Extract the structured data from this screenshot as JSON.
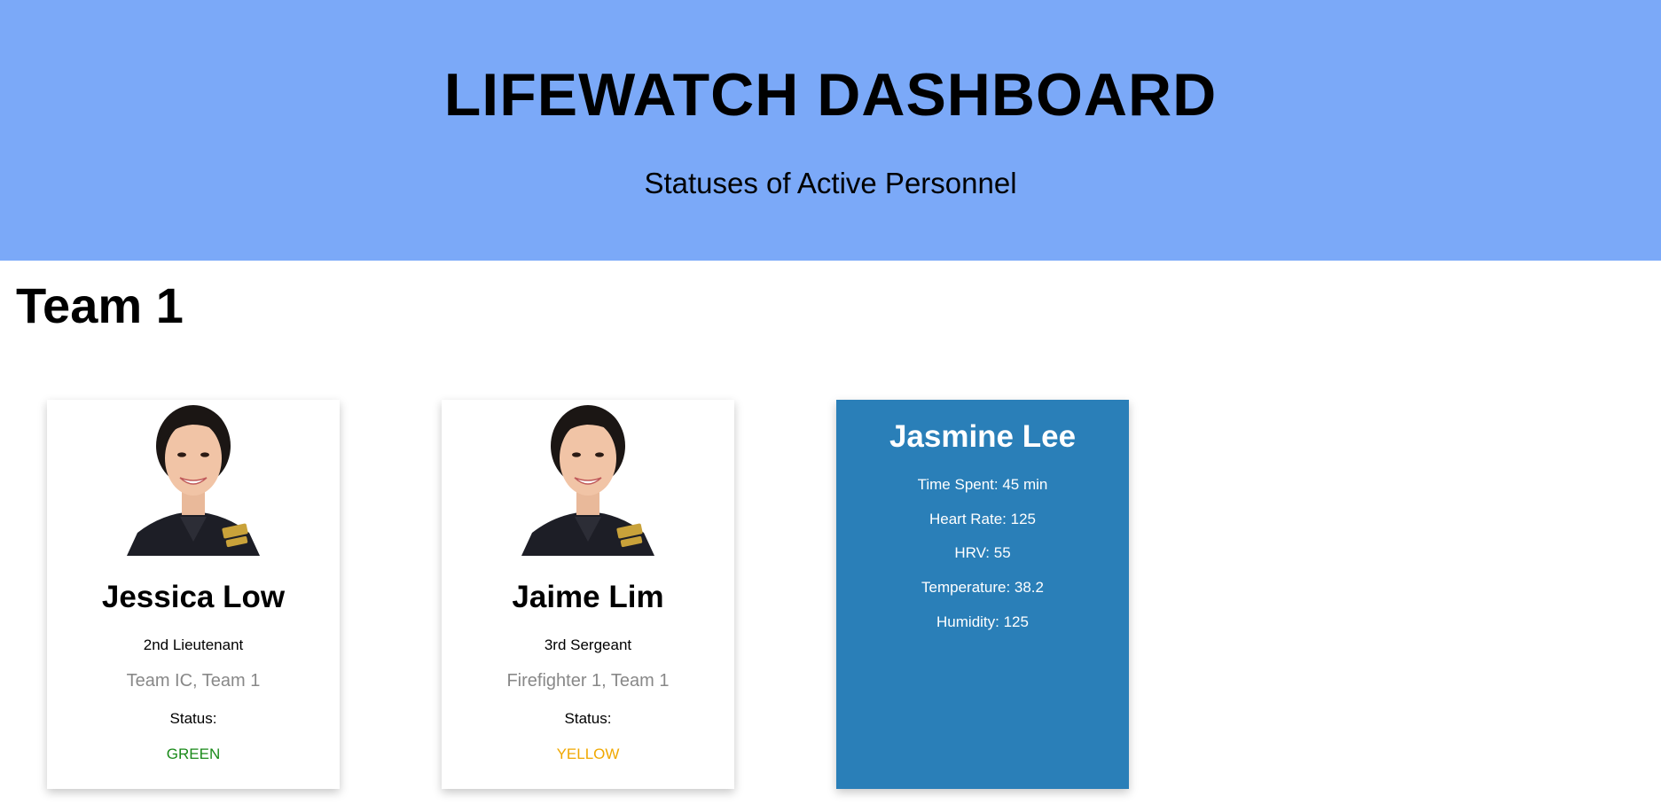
{
  "header": {
    "title": "LIFEWATCH DASHBOARD",
    "subtitle": "Statuses of Active Personnel"
  },
  "team": {
    "title": "Team 1"
  },
  "cards": [
    {
      "name": "Jessica Low",
      "rank": "2nd Lieutenant",
      "role": "Team IC, Team 1",
      "status_label": "Status:",
      "status_value": "GREEN",
      "status_color": "#1a8a1a"
    },
    {
      "name": "Jaime Lim",
      "rank": "3rd Sergeant",
      "role": "Firefighter 1, Team 1",
      "status_label": "Status:",
      "status_value": "YELLOW",
      "status_color": "#f0a800"
    }
  ],
  "details_card": {
    "name": "Jasmine Lee",
    "metrics": [
      "Time Spent: 45 min",
      "Heart Rate: 125",
      "HRV: 55",
      "Temperature: 38.2",
      "Humidity: 125"
    ],
    "background_color": "#2a7fb8"
  },
  "colors": {
    "header_bg": "#7ba9f8"
  }
}
